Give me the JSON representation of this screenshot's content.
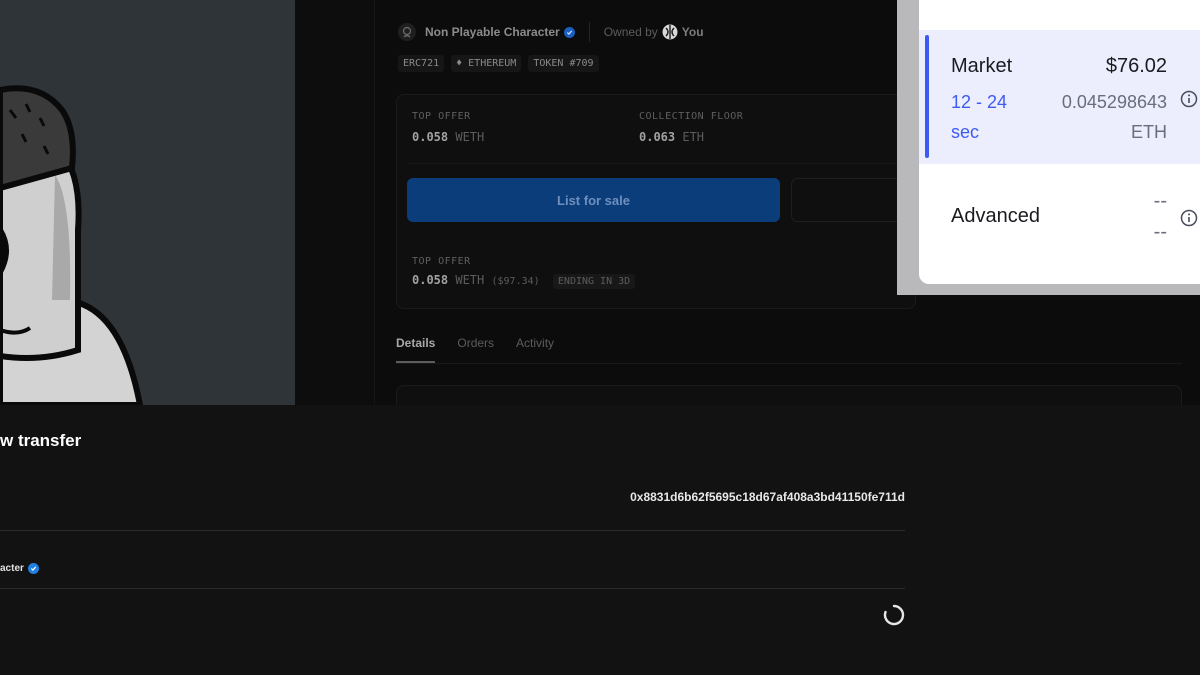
{
  "collection": {
    "name": "Non Playable Character",
    "owned_label": "Owned by",
    "owner": "You"
  },
  "chips": [
    "ERC721",
    "♦ ETHEREUM",
    "TOKEN #709"
  ],
  "stats": {
    "top_offer": {
      "label": "TOP OFFER",
      "amount": "0.058",
      "unit": "WETH"
    },
    "collection_floor": {
      "label": "COLLECTION FLOOR",
      "amount": "0.063",
      "unit": "ETH"
    }
  },
  "list_button": "List for sale",
  "offer_row": {
    "label": "TOP OFFER",
    "amount": "0.058",
    "unit": "WETH",
    "usd": "($97.34)",
    "badge": "ENDING IN 3D"
  },
  "tabs": [
    "Details",
    "Orders",
    "Activity"
  ],
  "gas_popup": {
    "market": {
      "label": "Market",
      "usd": "$76.02",
      "time_line1": "12 - 24",
      "time_line2": "sec",
      "eth_amount": "0.045298643",
      "eth_unit": "ETH"
    },
    "advanced": {
      "label": "Advanced",
      "value_line1": "--",
      "value_line2": "--"
    },
    "accent_color": "#3d5af1"
  },
  "transfer": {
    "title": "w transfer",
    "address": "0x8831d6b62f5695c18d67af408a3bd41150fe711d",
    "collection_fragment": "acter"
  }
}
